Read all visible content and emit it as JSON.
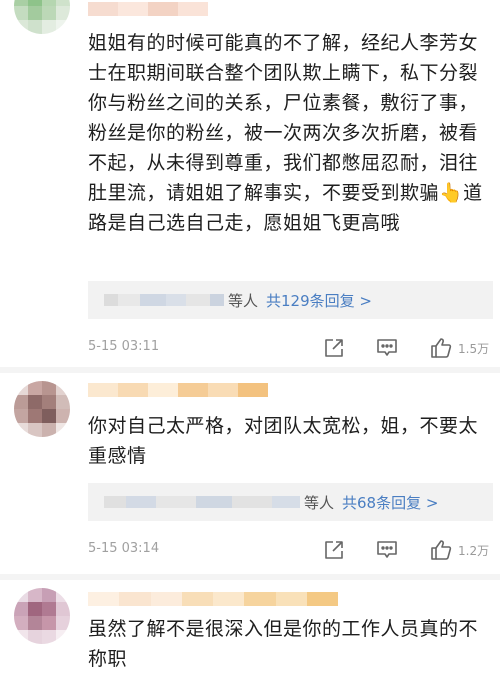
{
  "comments": [
    {
      "text": "姐姐有的时候可能真的不了解，经纪人李芳女士在职期间联合整个团队欺上瞒下，私下分裂你与粉丝之间的关系，尸位素餐，敷衍了事，粉丝是你的粉丝，被一次两次多次折磨，被看不起，从未得到尊重，我们都憋屈忍耐，泪往肚里流，请姐姐了解事实，不要受到欺骗👆道路是自己选自己走，愿姐姐飞更高哦",
      "reply_suffix": "等人",
      "reply_link": "共129条回复 >",
      "time": "5-15 03:11",
      "likes": "1.5万"
    },
    {
      "text": "你对自己太严格，对团队太宽松，姐，不要太重感情",
      "reply_suffix": "等人",
      "reply_link": "共68条回复 >",
      "time": "5-15 03:14",
      "likes": "1.2万"
    },
    {
      "text": "虽然了解不是很深入但是你的工作人员真的不称职"
    }
  ],
  "icons": {
    "share": "share-icon",
    "comment": "comment-icon",
    "like": "thumbs-up-icon"
  },
  "colors": {
    "link": "#4a7ec2",
    "meta": "#a0a0a0",
    "reply_bg": "#f2f2f2"
  }
}
